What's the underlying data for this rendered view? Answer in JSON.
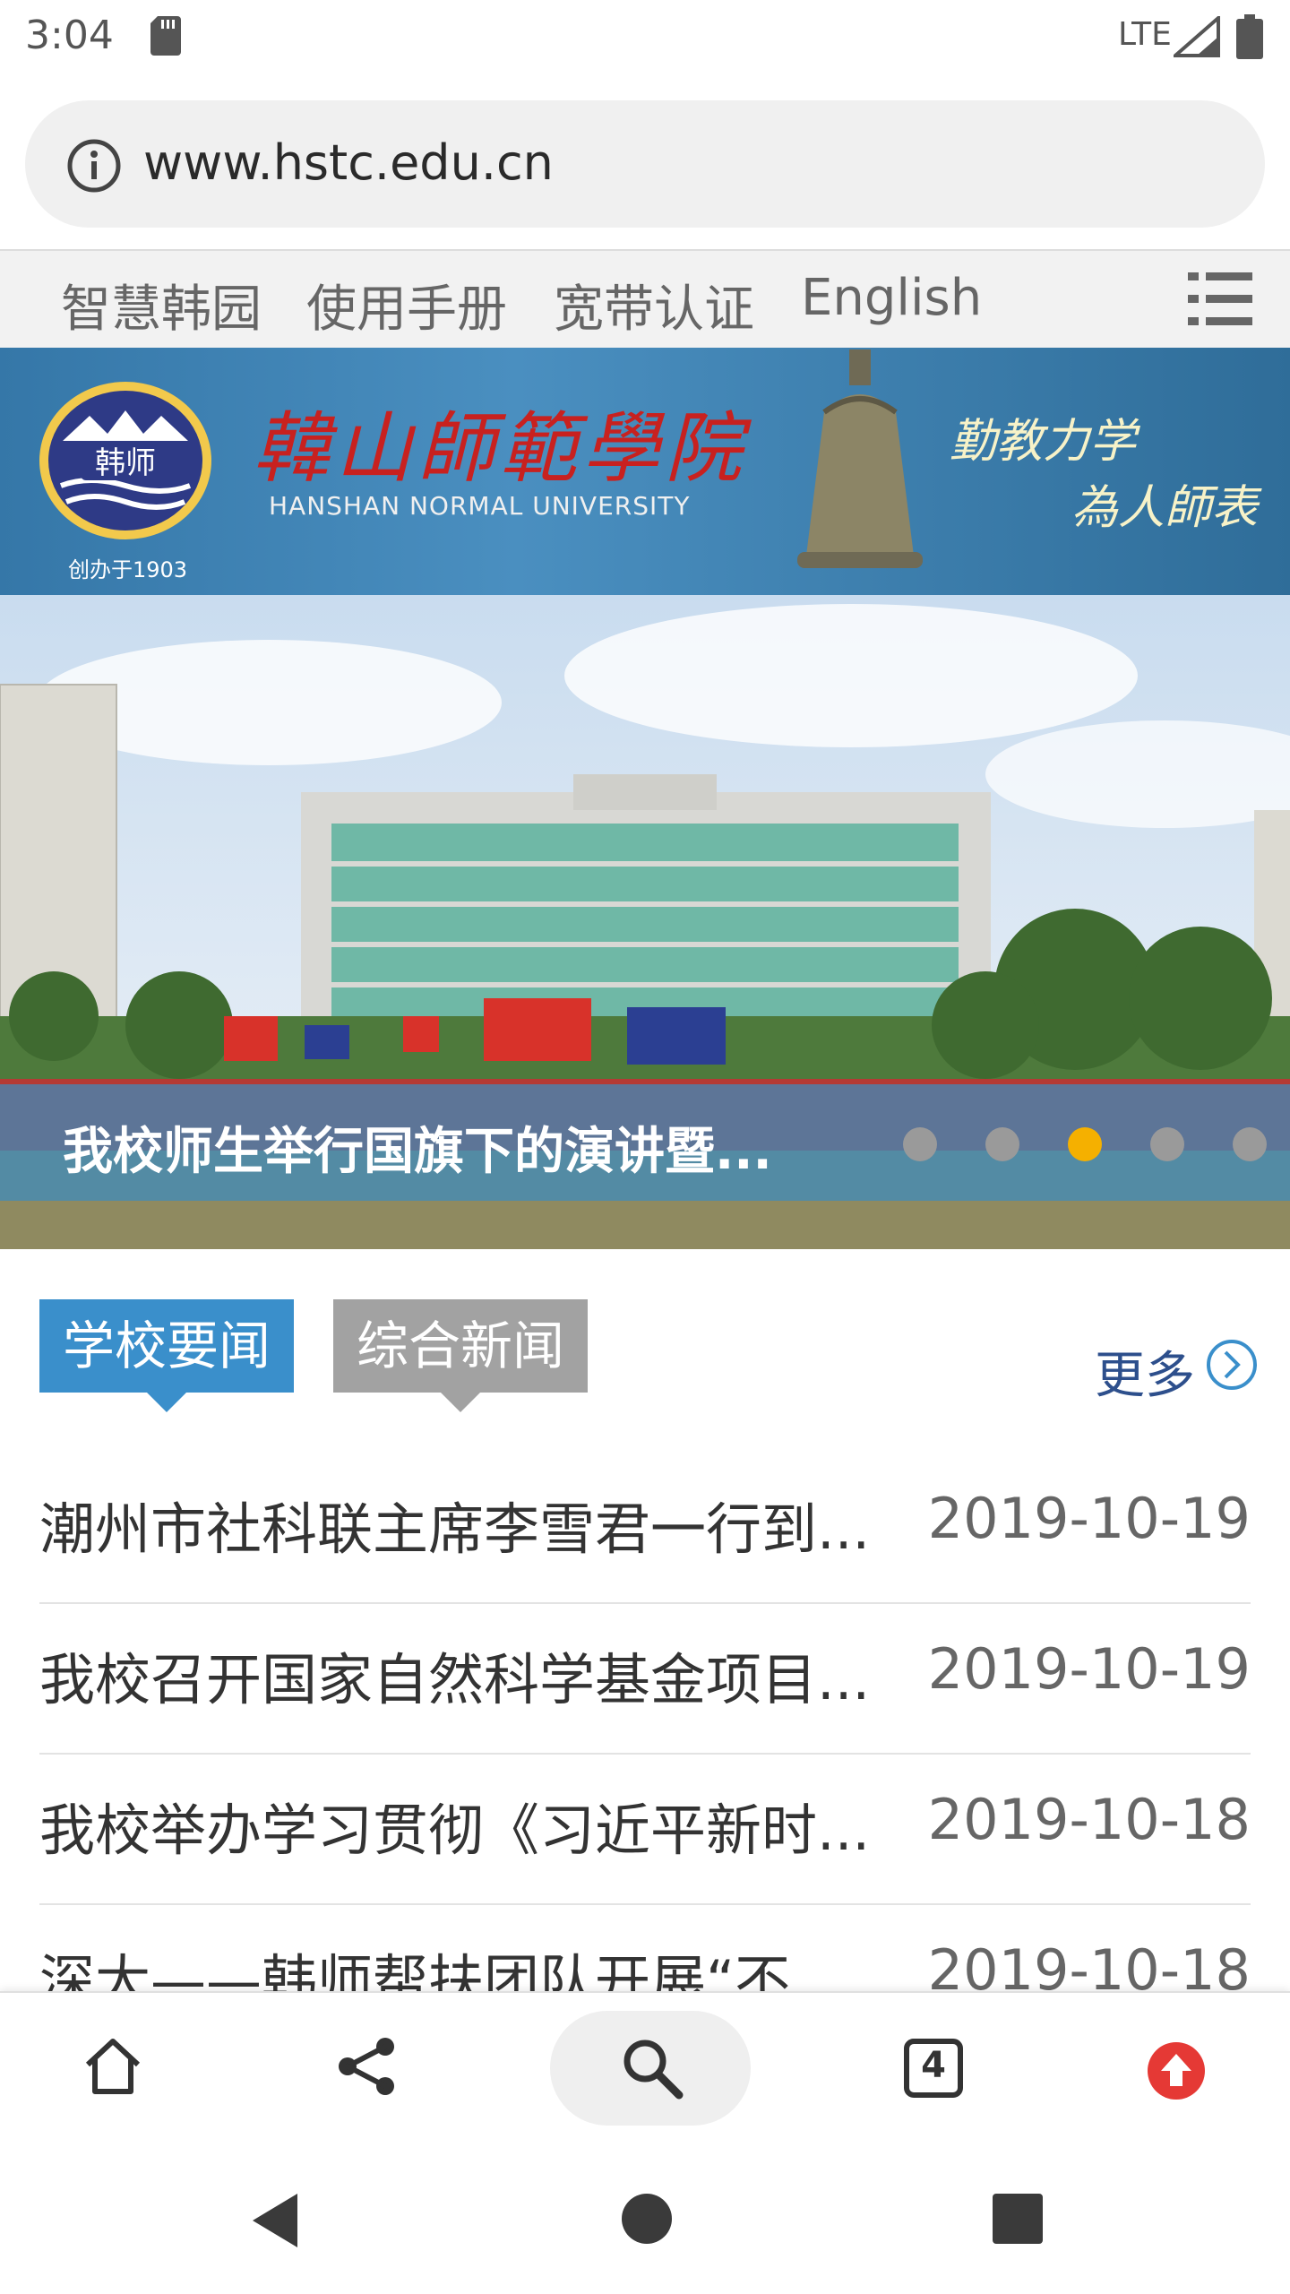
{
  "status_bar": {
    "time": "3:04",
    "network": "LTE"
  },
  "url_bar": {
    "url": "www.hstc.edu.cn"
  },
  "site_nav": {
    "items": [
      "智慧韩园",
      "使用手册",
      "宽带认证",
      "English"
    ]
  },
  "banner": {
    "logo_text": "韩师",
    "founded": "创办于1903",
    "school_name_cn": "韓山師範學院",
    "school_name_en": "HANSHAN NORMAL UNIVERSITY",
    "motto_line1": "勤教力学",
    "motto_line2": "為人師表"
  },
  "carousel": {
    "caption": "我校师生举行国旗下的演讲暨...",
    "slide_count": 5,
    "active_index": 2
  },
  "news": {
    "tabs": [
      "学校要闻",
      "综合新闻"
    ],
    "active_tab": 0,
    "more_label": "更多",
    "items": [
      {
        "title": "潮州市社科联主席李雪君一行到...",
        "date": "2019-10-19"
      },
      {
        "title": "我校召开国家自然科学基金项目...",
        "date": "2019-10-19"
      },
      {
        "title": "我校举办学习贯彻《习近平新时...",
        "date": "2019-10-18"
      },
      {
        "title": "深大——韩师帮扶团队开展“不...",
        "date": "2019-10-18"
      }
    ]
  },
  "toolbar": {
    "tab_count": "4"
  },
  "colors": {
    "tab_active": "#3a8fcb",
    "tab_inactive": "#a2a2a2",
    "dot_active": "#f5b000",
    "update_red": "#e53935",
    "more_blue": "#2d4f8c"
  }
}
